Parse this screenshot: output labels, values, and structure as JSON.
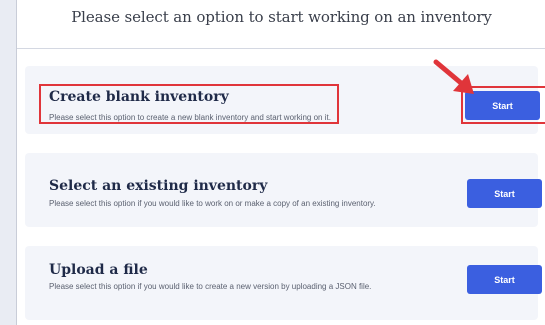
{
  "header": {
    "title": "Please select an option to start working on an inventory"
  },
  "options": [
    {
      "title": "Create blank inventory",
      "description": "Please select this option to create a new blank inventory and start working on it.",
      "button_label": "Start"
    },
    {
      "title": "Select an existing inventory",
      "description": "Please select this option if you would like to work on or make a copy of an existing inventory.",
      "button_label": "Start"
    },
    {
      "title": "Upload a file",
      "description": "Please select this option if you would like to create a new version by uploading a JSON file.",
      "button_label": "Start"
    }
  ],
  "colors": {
    "accent": "#3b5fe0",
    "highlight": "#e0353a"
  },
  "icons": {
    "annotation": "arrow-pointer-icon"
  }
}
